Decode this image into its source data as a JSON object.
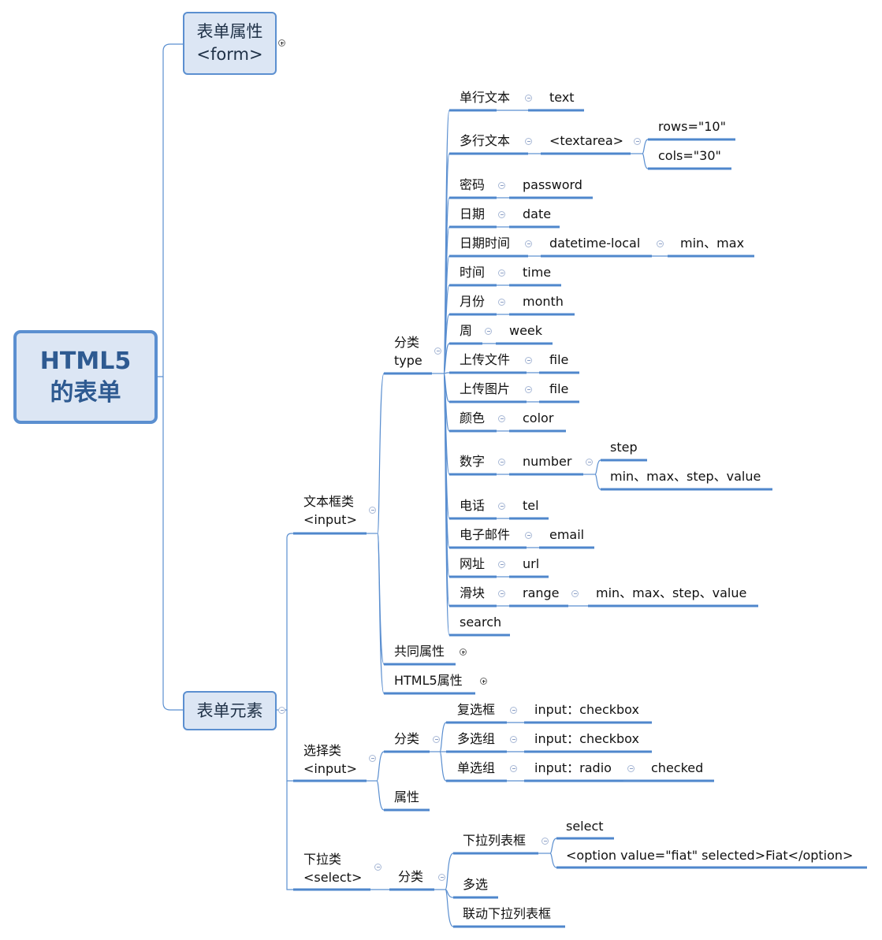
{
  "colors": {
    "branch": "#5b8fd0",
    "underline": "#4f87cc",
    "box_fill": "#dce6f4",
    "root_text": "#2e5a91"
  },
  "root": {
    "line1": "HTML5",
    "line2": "的表单"
  },
  "form_attrs": {
    "line1": "表单属性",
    "line2": "<form>",
    "toggle": "expand-collapsed"
  },
  "form_elements": {
    "label": "表单元素",
    "text_inputs": {
      "line1": "文本框类",
      "line2": "<input>",
      "type_group": {
        "line1": "分类",
        "line2": "type",
        "items": [
          {
            "label": "单行文本",
            "value": "text"
          },
          {
            "label": "多行文本",
            "value": "<textarea>",
            "children": [
              "rows=\"10\"",
              "cols=\"30\""
            ]
          },
          {
            "label": "密码",
            "value": "password"
          },
          {
            "label": "日期",
            "value": "date"
          },
          {
            "label": "日期时间",
            "value": "datetime-local",
            "children": [
              "min、max"
            ]
          },
          {
            "label": "时间",
            "value": "time"
          },
          {
            "label": "月份",
            "value": "month"
          },
          {
            "label": "周",
            "value": "week"
          },
          {
            "label": "上传文件",
            "value": "file"
          },
          {
            "label": "上传图片",
            "value": "file"
          },
          {
            "label": "颜色",
            "value": "color"
          },
          {
            "label": "数字",
            "value": "number",
            "children": [
              "step",
              "min、max、step、value"
            ]
          },
          {
            "label": "电话",
            "value": "tel"
          },
          {
            "label": "电子邮件",
            "value": "email"
          },
          {
            "label": "网址",
            "value": "url"
          },
          {
            "label": "滑块",
            "value": "range",
            "children": [
              "min、max、step、value"
            ]
          },
          {
            "label": "search"
          }
        ]
      },
      "common_attrs": "共同属性",
      "html5_attrs": "HTML5属性"
    },
    "choice_inputs": {
      "line1": "选择类",
      "line2": "<input>",
      "category": "分类",
      "items": [
        {
          "label": "复选框",
          "value": "input：checkbox"
        },
        {
          "label": "多选组",
          "value": "input：checkbox"
        },
        {
          "label": "单选组",
          "value": "input：radio",
          "children": [
            "checked"
          ]
        }
      ],
      "attrs": "属性"
    },
    "select_inputs": {
      "line1": "下拉类",
      "line2": "<select>",
      "category": "分类",
      "dropdown": {
        "label": "下拉列表框",
        "children": [
          "select",
          "<option value=\"fiat\" selected>Fiat</option>"
        ]
      },
      "multi": "多选",
      "linked": "联动下拉列表框"
    }
  }
}
